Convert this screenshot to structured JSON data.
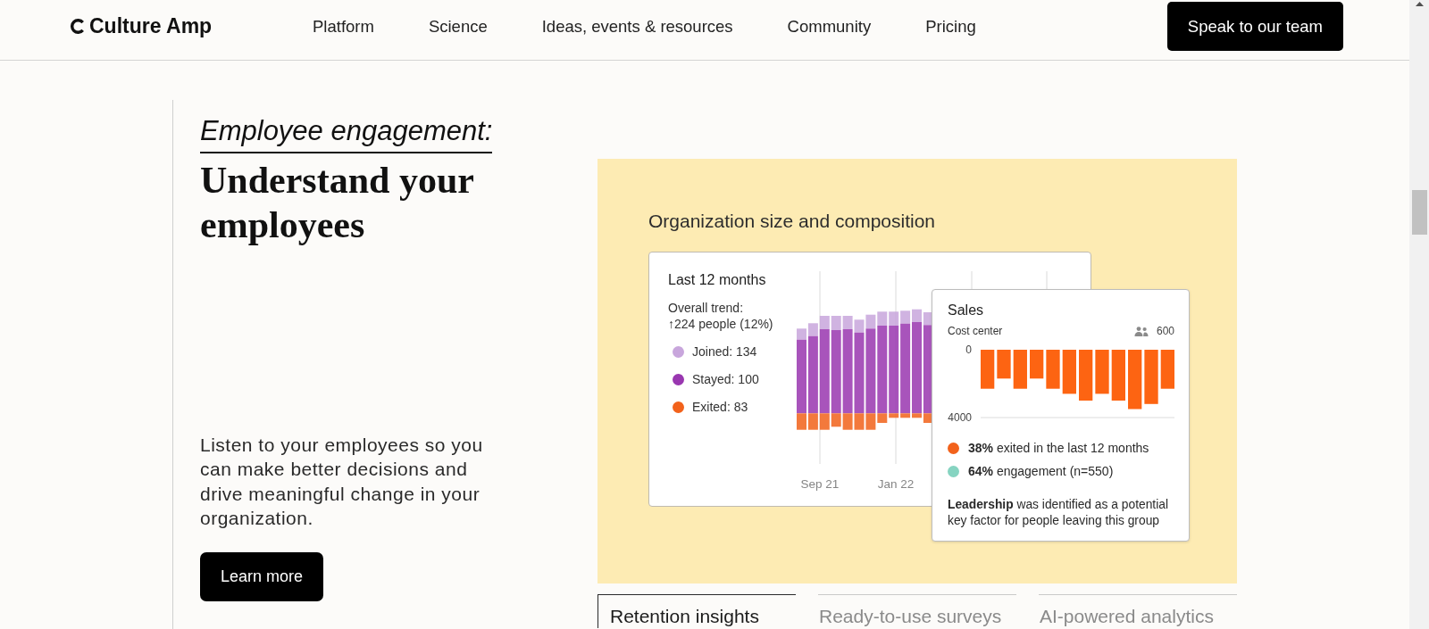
{
  "header": {
    "logo": "Culture Amp",
    "nav": [
      "Platform",
      "Science",
      "Ideas, events & resources",
      "Community",
      "Pricing"
    ],
    "cta": "Speak to our team"
  },
  "intro": {
    "eyebrow": "Employee engagement:",
    "heading": "Understand your employees",
    "body": "Listen to your employees so you can make better decisions and drive meaningful change in your organization.",
    "button": "Learn more"
  },
  "panel": {
    "title": "Organization size and composition",
    "trend_card": {
      "title": "Last 12 months",
      "trend_label": "Overall trend:",
      "trend_value": "↑224 people (12%)",
      "legend": [
        {
          "label": "Joined: 134",
          "color": "#c8a6dc"
        },
        {
          "label": "Stayed: 100",
          "color": "#9937b0"
        },
        {
          "label": "Exited: 83",
          "color": "#f2621b"
        }
      ],
      "x_labels": [
        "Sep 21",
        "Jan 22"
      ]
    },
    "detail_card": {
      "title": "Sales",
      "subtitle": "Cost center",
      "headcount": "600",
      "chart_data": {
        "type": "bar",
        "categories": [
          null,
          null,
          null,
          null,
          null,
          null,
          null,
          null,
          null,
          null,
          null,
          null
        ],
        "ylim": [
          4000,
          0
        ],
        "yticks": [
          0,
          4000
        ],
        "series": [
          {
            "color": "#fd6412",
            "values": [
              2300,
              1700,
              2300,
              1700,
              2300,
              2600,
              3000,
              2600,
              3000,
              3500,
              3200,
              2300
            ]
          }
        ]
      },
      "stats": [
        {
          "text": "**38%** exited in the last 12 months",
          "color": "#f2621b"
        },
        {
          "text": "**64%** engagement (n=550)",
          "color": "#86d4c1"
        }
      ],
      "note": "**Leadership** was identified as a potential key factor for people leaving this group"
    }
  },
  "tabs": [
    {
      "label": "Retention insights",
      "selected": true
    },
    {
      "label": "Ready-to-use surveys",
      "selected": false
    },
    {
      "label": "AI-powered analytics",
      "selected": false
    }
  ]
}
